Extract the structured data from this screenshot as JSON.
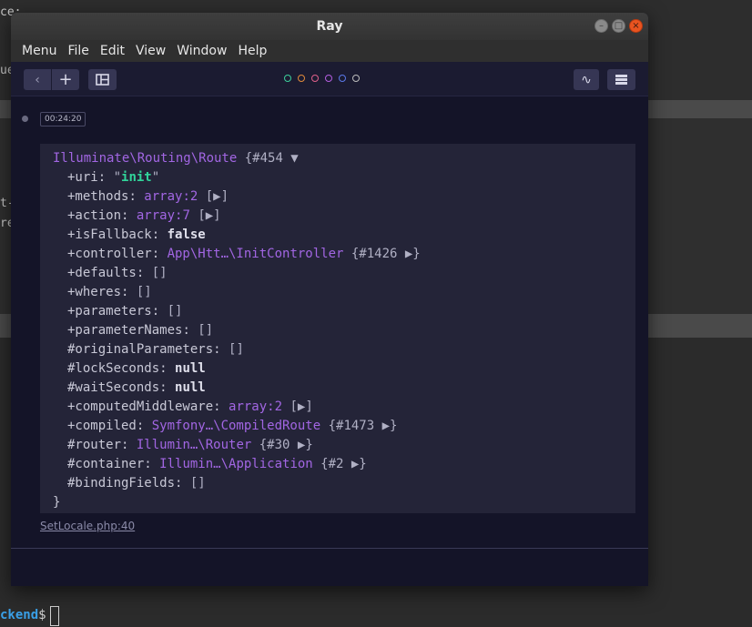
{
  "window": {
    "title": "Ray",
    "controls": {
      "minimize": "–",
      "maximize": "□",
      "close": "×"
    }
  },
  "menubar": {
    "items": [
      "Menu",
      "File",
      "Edit",
      "View",
      "Window",
      "Help"
    ]
  },
  "toolbar": {
    "back_icon": "‹",
    "add_icon": "+",
    "layout_icon": "layout-icon",
    "wave_icon": "∿",
    "list_icon": "list-icon",
    "color_dots": [
      "#3ccf9b",
      "#e08a3c",
      "#e0608a",
      "#b45ee0",
      "#5a78e8",
      "#bdbdbd"
    ]
  },
  "entry": {
    "timestamp": "00:24:20",
    "source": "SetLocale.php:40",
    "dump": {
      "header_class": "Illuminate\\Routing\\Route",
      "header_id": " {#454 ▼",
      "closing": "}",
      "rows": [
        {
          "key": "+uri",
          "parts": [
            {
              "text": "\"",
              "style": "muted"
            },
            {
              "text": "init",
              "style": "str"
            },
            {
              "text": "\"",
              "style": "muted"
            }
          ]
        },
        {
          "key": "+methods",
          "parts": [
            {
              "text": "array:2",
              "style": "cls"
            },
            {
              "text": " [▶]",
              "style": "muted"
            }
          ]
        },
        {
          "key": "+action",
          "parts": [
            {
              "text": "array:7",
              "style": "cls"
            },
            {
              "text": " [▶]",
              "style": "muted"
            }
          ]
        },
        {
          "key": "+isFallback",
          "parts": [
            {
              "text": "false",
              "style": "bool"
            }
          ]
        },
        {
          "key": "+controller",
          "parts": [
            {
              "text": "App\\Htt…\\InitController",
              "style": "cls"
            },
            {
              "text": " {#1426 ▶}",
              "style": "muted"
            }
          ]
        },
        {
          "key": "+defaults",
          "parts": [
            {
              "text": "[]",
              "style": "muted"
            }
          ]
        },
        {
          "key": "+wheres",
          "parts": [
            {
              "text": "[]",
              "style": "muted"
            }
          ]
        },
        {
          "key": "+parameters",
          "parts": [
            {
              "text": "[]",
              "style": "muted"
            }
          ]
        },
        {
          "key": "+parameterNames",
          "parts": [
            {
              "text": "[]",
              "style": "muted"
            }
          ]
        },
        {
          "key": "#originalParameters",
          "parts": [
            {
              "text": "[]",
              "style": "muted"
            }
          ]
        },
        {
          "key": "#lockSeconds",
          "parts": [
            {
              "text": "null",
              "style": "bool"
            }
          ]
        },
        {
          "key": "#waitSeconds",
          "parts": [
            {
              "text": "null",
              "style": "bool"
            }
          ]
        },
        {
          "key": "+computedMiddleware",
          "parts": [
            {
              "text": "array:2",
              "style": "cls"
            },
            {
              "text": " [▶]",
              "style": "muted"
            }
          ]
        },
        {
          "key": "+compiled",
          "parts": [
            {
              "text": "Symfony…\\CompiledRoute",
              "style": "cls"
            },
            {
              "text": " {#1473 ▶}",
              "style": "muted"
            }
          ]
        },
        {
          "key": "#router",
          "parts": [
            {
              "text": "Illumin…\\Router",
              "style": "cls"
            },
            {
              "text": " {#30 ▶}",
              "style": "muted"
            }
          ]
        },
        {
          "key": "#container",
          "parts": [
            {
              "text": "Illumin…\\Application",
              "style": "cls"
            },
            {
              "text": " {#2 ▶}",
              "style": "muted"
            }
          ]
        },
        {
          "key": "#bindingFields",
          "parts": [
            {
              "text": "[]",
              "style": "muted"
            }
          ]
        }
      ]
    }
  },
  "background_terminal": {
    "snippets": [
      "ce:",
      "ue",
      "t-",
      "re"
    ],
    "prompt": "ckend",
    "prompt_suffix": "$"
  }
}
